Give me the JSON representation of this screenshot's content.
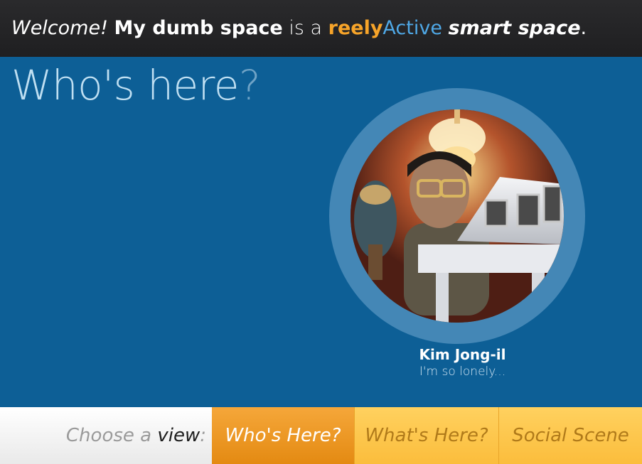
{
  "header": {
    "welcome": "Welcome!",
    "space_name": "My dumb space",
    "connector": "is a",
    "brand_reely": "reely",
    "brand_active": "Active",
    "smart_space": "smart space",
    "period": "."
  },
  "page": {
    "title_main": "Who's here",
    "title_mark": "?"
  },
  "person": {
    "name": "Kim Jong-il",
    "status": "I'm so lonely..."
  },
  "nav": {
    "choose_prefix": "Choose a",
    "choose_view": "view",
    "choose_colon": ":",
    "tabs": [
      {
        "label": "Who's Here?",
        "active": true
      },
      {
        "label": "What's Here?",
        "active": false
      },
      {
        "label": "Social Scene",
        "active": false
      }
    ]
  },
  "colors": {
    "brand_orange": "#f7a429",
    "brand_blue": "#4fa8e6",
    "background_blue": "#0d5f96",
    "active_tab": "#f0a02a",
    "inactive_tab": "#fdc84e"
  }
}
